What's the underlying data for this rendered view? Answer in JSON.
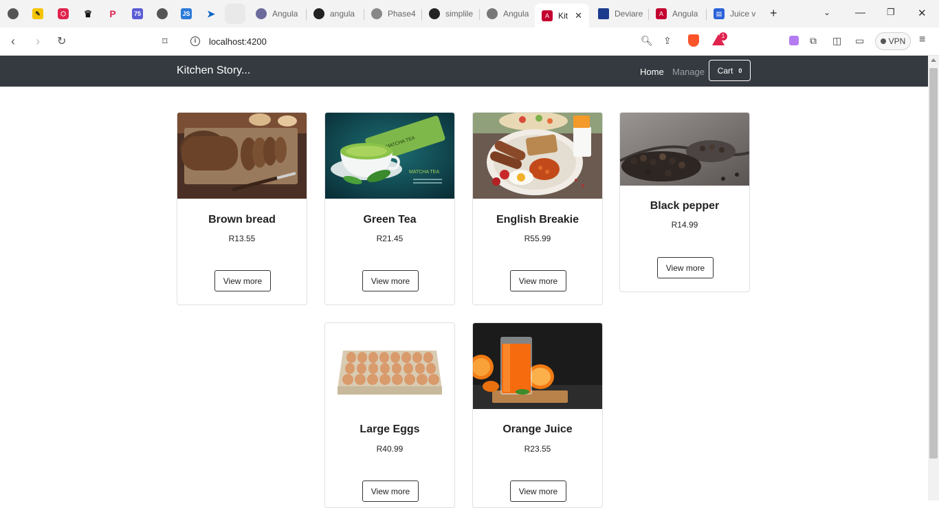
{
  "browser": {
    "tabs": [
      {
        "label": "Angula"
      },
      {
        "label": "angula"
      },
      {
        "label": "Phase4"
      },
      {
        "label": "simplile"
      },
      {
        "label": "Angula"
      },
      {
        "label": "Kit"
      },
      {
        "label": "Deviare"
      },
      {
        "label": "Angula"
      },
      {
        "label": "Juice v"
      }
    ],
    "pinned_badge": "75",
    "js_badge": "JS",
    "new_tab": "+",
    "url": "localhost:4200",
    "vpn_label": "VPN",
    "notification_count": "1"
  },
  "navbar": {
    "brand": "Kitchen Story...",
    "home": "Home",
    "manage": "Manage",
    "cart_label": "Cart",
    "cart_count": "0"
  },
  "products": [
    {
      "name": "Brown bread",
      "price": "R13.55",
      "button": "View more"
    },
    {
      "name": "Green Tea",
      "price": "R21.45",
      "button": "View more"
    },
    {
      "name": "English Breakie",
      "price": "R55.99",
      "button": "View more"
    },
    {
      "name": "Black pepper",
      "price": "R14.99",
      "button": "View more"
    },
    {
      "name": "Large Eggs",
      "price": "R40.99",
      "button": "View more"
    },
    {
      "name": "Orange Juice",
      "price": "R23.55",
      "button": "View more"
    }
  ],
  "image_text": {
    "matcha_pack": "MATCHA TEA",
    "matcha_label": "MATCHA TEA"
  }
}
